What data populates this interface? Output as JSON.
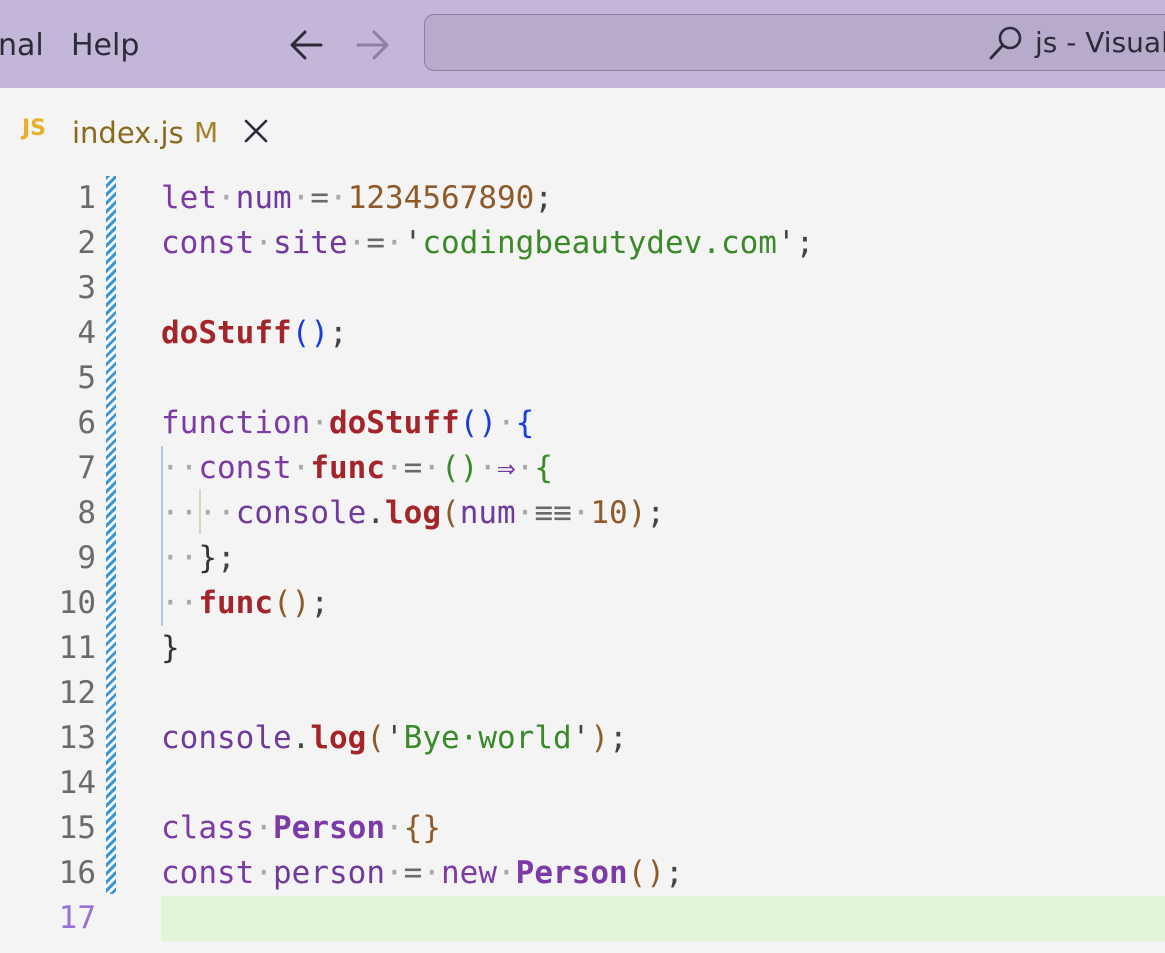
{
  "titlebar": {
    "menu": [
      "nal",
      "Help"
    ],
    "search_text": "js - Visual"
  },
  "tab": {
    "lang_badge": "JS",
    "filename": "index.js",
    "status": "M"
  },
  "editor": {
    "line_numbers": [
      "1",
      "2",
      "3",
      "4",
      "5",
      "6",
      "7",
      "8",
      "9",
      "10",
      "11",
      "12",
      "13",
      "14",
      "15",
      "16",
      "17"
    ],
    "active_line": "17",
    "lines": [
      {
        "raw": "let num = 1234567890;"
      },
      {
        "raw": "const site = 'codingbeautydev.com';"
      },
      {
        "raw": ""
      },
      {
        "raw": "doStuff();"
      },
      {
        "raw": ""
      },
      {
        "raw": "function doStuff() {"
      },
      {
        "raw": "  const func = () => {"
      },
      {
        "raw": "    console.log(num === 10);"
      },
      {
        "raw": "  };"
      },
      {
        "raw": "  func();"
      },
      {
        "raw": "}"
      },
      {
        "raw": ""
      },
      {
        "raw": "console.log('Bye world');"
      },
      {
        "raw": ""
      },
      {
        "raw": "class Person {}"
      },
      {
        "raw": "const person = new Person();"
      },
      {
        "raw": ""
      }
    ]
  },
  "colors": {
    "titlebar": "#c3b6d8",
    "editor_bg": "#f4f4f4",
    "current_line": "#e4f4d8",
    "keyword": "#7b3aa6",
    "function": "#a3252a",
    "string": "#3a8a2a",
    "number": "#8f5a2a",
    "bracket": "#1a3be0"
  }
}
